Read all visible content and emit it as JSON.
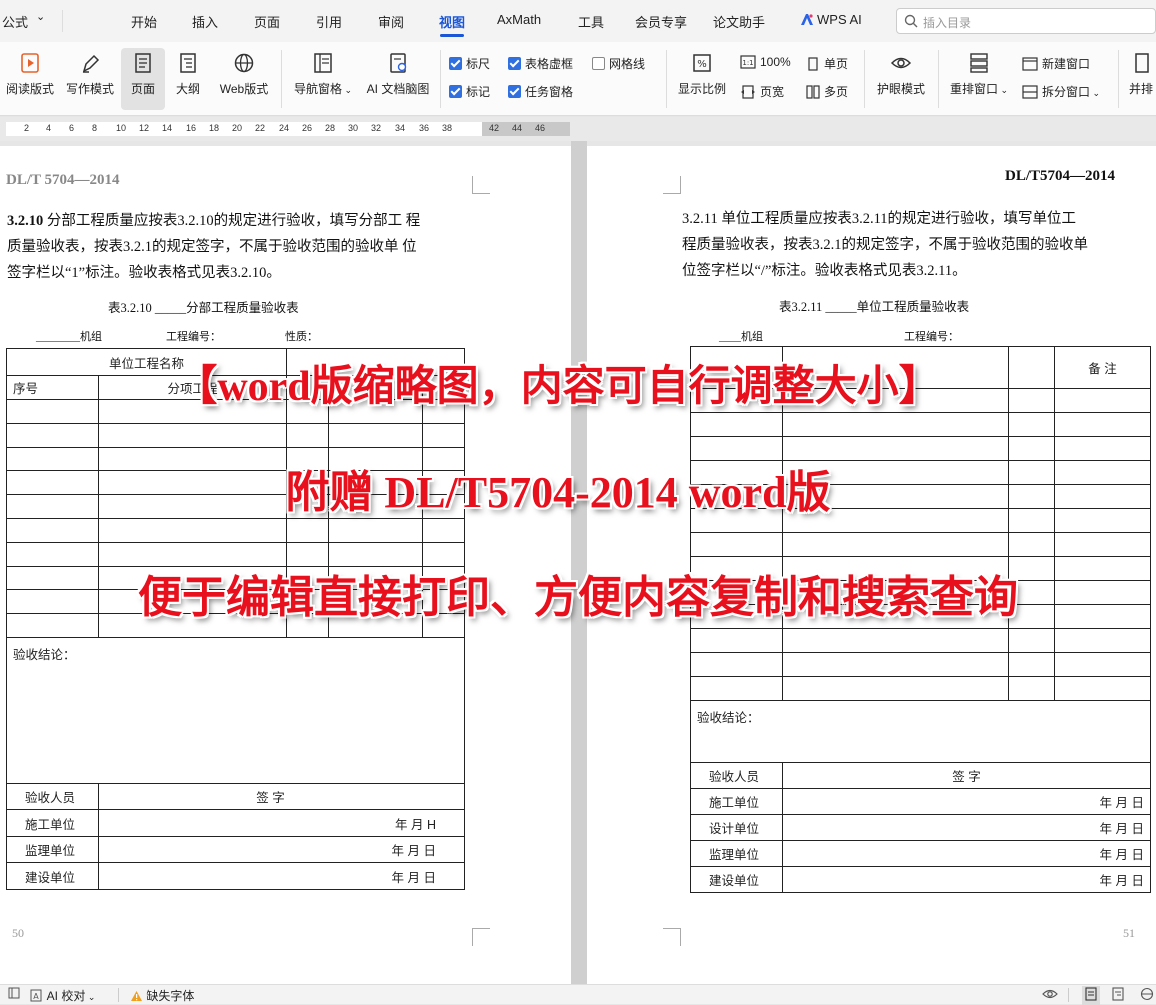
{
  "menubar": {
    "left_cut": "公式",
    "tabs": [
      "开始",
      "插入",
      "页面",
      "引用",
      "审阅",
      "视图",
      "AxMath",
      "工具",
      "会员专享",
      "论文助手",
      "WPS AI"
    ],
    "active_tab": "视图",
    "search_placeholder": "插入目录"
  },
  "ribbon": {
    "view_buttons": [
      "阅读版式",
      "写作模式",
      "页面",
      "大纲",
      "Web版式"
    ],
    "active_view": "页面",
    "nav_pane": "导航窗格",
    "ai_mindmap": "AI 文档脑图",
    "checks": [
      {
        "label": "标尺",
        "checked": true
      },
      {
        "label": "表格虚框",
        "checked": true
      },
      {
        "label": "网格线",
        "checked": false
      },
      {
        "label": "标记",
        "checked": true
      },
      {
        "label": "任务窗格",
        "checked": true
      }
    ],
    "zoom_label": "显示比例",
    "zoom_100": "100%",
    "page_width": "页宽",
    "single_page": "单页",
    "multi_page": "多页",
    "eye_mode": "护眼模式",
    "rearrange": "重排窗口",
    "new_window": "新建窗口",
    "split_window": "拆分窗口",
    "side_by_side": "并排"
  },
  "ruler": {
    "ticks": [
      "2",
      "4",
      "6",
      "8",
      "10",
      "12",
      "14",
      "16",
      "18",
      "20",
      "22",
      "24",
      "26",
      "28",
      "30",
      "32",
      "34",
      "36",
      "38",
      "42",
      "44",
      "46"
    ]
  },
  "left_page": {
    "header": "DL/T   5704—2014",
    "para_num": "3.2.10",
    "para_lines": [
      "分部工程质量应按表3.2.10的规定进行验收，填写分部工 程",
      "质量验收表，按表3.2.1的规定签字，不属于验收范围的验收单 位",
      "签字栏以“1”标注。验收表格式见表3.2.10。"
    ],
    "caption": "表3.2.10   _____分部工程质量验收表",
    "meta": [
      "________机组",
      "工程编号：",
      "性质："
    ],
    "row1_label": "单位工程名称",
    "col_seq": "序号",
    "col_name": "分项工程",
    "conclusion": "验收结论：",
    "sign_rows": [
      {
        "label": "验收人员",
        "value": "签  字"
      },
      {
        "label": "施工单位",
        "value": "年   月    H"
      },
      {
        "label": "监理单位",
        "value": "年   月   日"
      },
      {
        "label": "建设单位",
        "value": "年   月   日"
      }
    ],
    "page_no": "50"
  },
  "right_page": {
    "header": "DL/T5704—2014",
    "para_lines": [
      "3.2.11    单位工程质量应按表3.2.11的规定进行验收，填写单位工",
      "程质量验收表，按表3.2.1的规定签字，不属于验收范围的验收单",
      "位签字栏以“/”标注。验收表格式见表3.2.11。"
    ],
    "caption": "表3.2.11    _____单位工程质量验收表",
    "meta": [
      "____机组",
      "工程编号："
    ],
    "col_remark": "备  注",
    "conclusion": "验收结论：",
    "sign_rows": [
      {
        "label": "验收人员",
        "value": "签   字"
      },
      {
        "label": "施工单位",
        "value": "年   月   日"
      },
      {
        "label": "设计单位",
        "value": "年   月    日"
      },
      {
        "label": "监理单位",
        "value": "年   月    日"
      },
      {
        "label": "建设单位",
        "value": "年   月    日"
      }
    ],
    "page_no": "51"
  },
  "overlay": {
    "line1": "【word版缩略图，内容可自行调整大小】",
    "line2": "附赠 DL/T5704-2014 word版",
    "line3": "便于编辑直接打印、方便内容复制和搜索查询",
    "color": "#e8101c"
  },
  "statusbar": {
    "proofread": "AI 校对",
    "missing_font": "缺失字体"
  }
}
